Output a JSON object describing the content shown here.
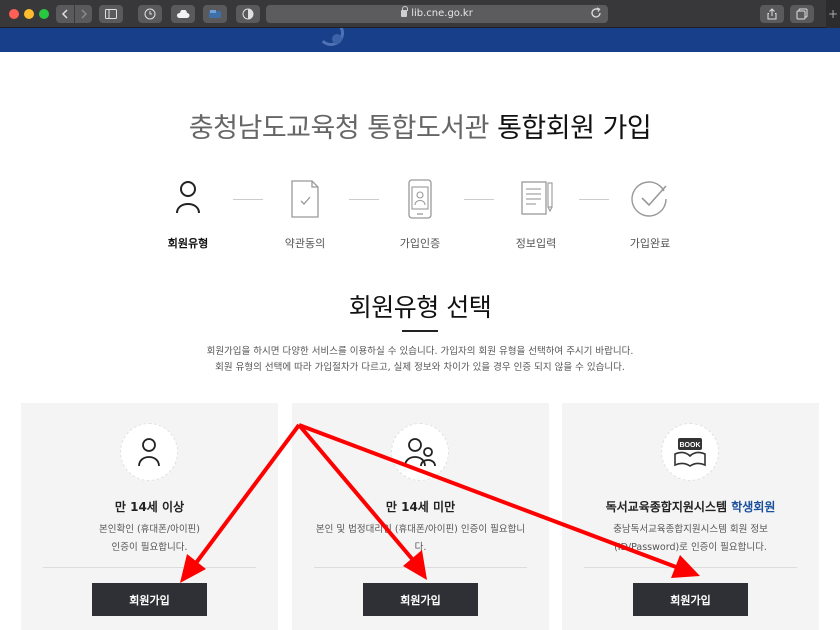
{
  "browser": {
    "url": "lib.cne.go.kr",
    "new_tab": "+"
  },
  "title": {
    "muted": "충청남도교육청 통합도서관",
    "strong": "통합회원 가입"
  },
  "steps": [
    {
      "label": "회원유형",
      "icon": "person-icon",
      "active": true
    },
    {
      "label": "약관동의",
      "icon": "document-check-icon",
      "active": false
    },
    {
      "label": "가입인증",
      "icon": "phone-id-icon",
      "active": false
    },
    {
      "label": "정보입력",
      "icon": "form-pen-icon",
      "active": false
    },
    {
      "label": "가입완료",
      "icon": "check-circle-icon",
      "active": false
    }
  ],
  "section": {
    "title": "회원유형 선택",
    "desc_line1": "회원가입을 하시면 다양한 서비스를 이용하실 수 있습니다. 가입자의 회원 유형을 선택하여 주시기 바랍니다.",
    "desc_line2": "회원 유형의 선택에 따라 가입절차가 다르고, 실제 정보와 차이가 있을 경우 인증 되지 않을 수 있습니다."
  },
  "cards": [
    {
      "title": "만 14세 이상",
      "desc_line1": "본인확인 (휴대폰/아이핀)",
      "desc_line2": "인증이 필요합니다.",
      "button": "회원가입",
      "icon": "person-icon"
    },
    {
      "title": "만 14세 미만",
      "desc_line1": "본인 및 법정대리인 (휴대폰/아이핀) 인증이 필요합니",
      "desc_line2": "다.",
      "button": "회원가입",
      "icon": "parent-child-icon"
    },
    {
      "title_prefix": "독서교육종합지원시스템",
      "title_highlight": "학생회원",
      "desc_line1": "충남독서교육종합지원시스템 회원 정보",
      "desc_line2": "(ID/Password)로 인증이 필요합니다.",
      "button": "회원가입",
      "icon": "book-icon",
      "icon_text": "BOOK"
    }
  ],
  "colors": {
    "header": "#173f8a",
    "highlight": "#1a4f9c",
    "button": "#2f3035",
    "arrow": "#ff0000"
  }
}
